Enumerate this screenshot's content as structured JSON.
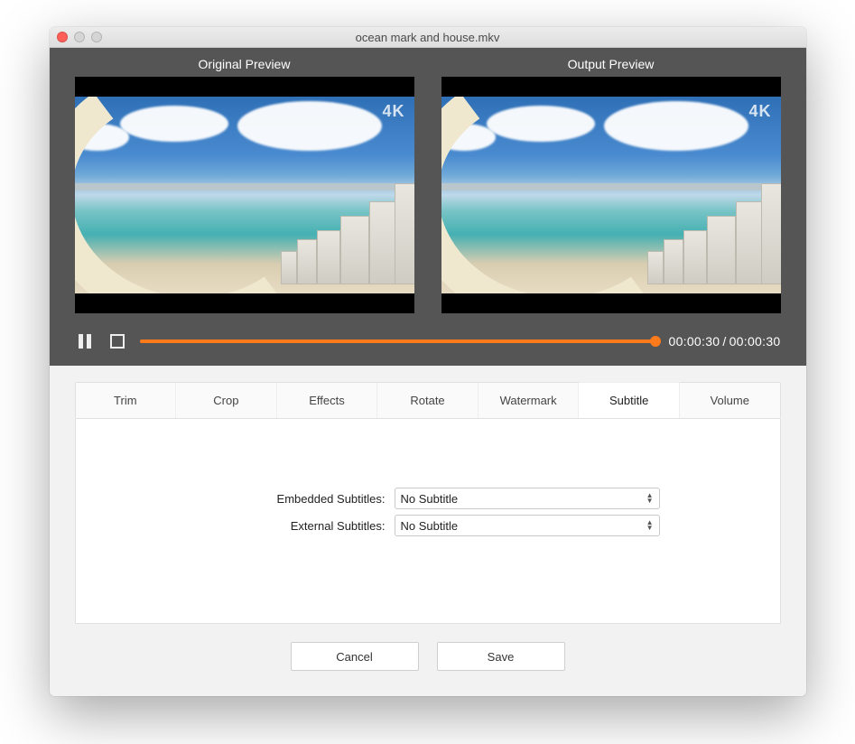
{
  "window": {
    "title": "ocean mark and house.mkv"
  },
  "preview": {
    "original_label": "Original Preview",
    "output_label": "Output  Preview",
    "badge": "4K"
  },
  "transport": {
    "current_time": "00:00:30",
    "total_time": "00:00:30"
  },
  "tabs": {
    "items": [
      "Trim",
      "Crop",
      "Effects",
      "Rotate",
      "Watermark",
      "Subtitle",
      "Volume"
    ],
    "active_index": 5
  },
  "subtitle_form": {
    "embedded_label": "Embedded Subtitles:",
    "embedded_value": "No Subtitle",
    "external_label": "External Subtitles:",
    "external_value": "No Subtitle"
  },
  "actions": {
    "cancel": "Cancel",
    "save": "Save"
  }
}
